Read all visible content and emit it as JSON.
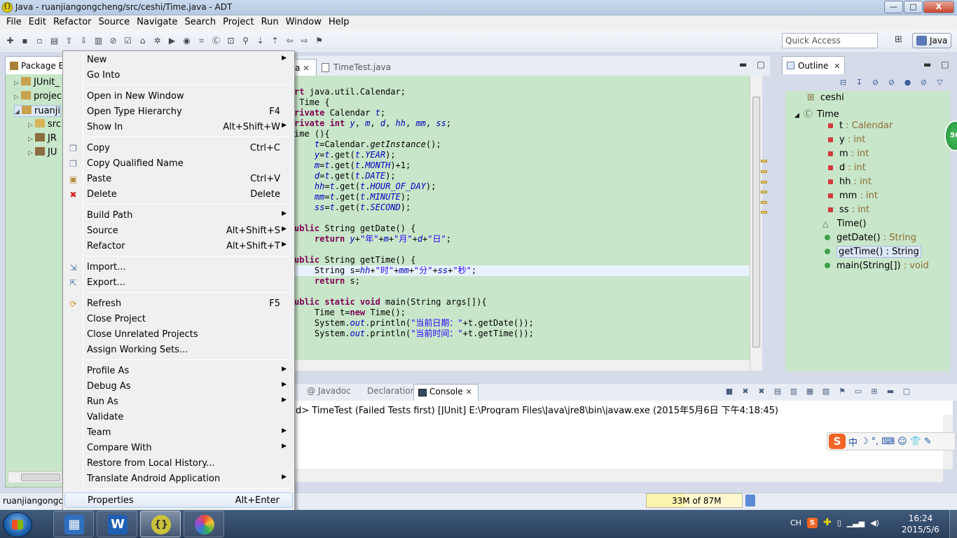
{
  "window": {
    "title": "Java - ruanjiangongcheng/src/ceshi/Time.java - ADT",
    "app_icon": "{}",
    "buttons": [
      "—",
      "□",
      "X"
    ]
  },
  "menubar": [
    "File",
    "Edit",
    "Refactor",
    "Source",
    "Navigate",
    "Search",
    "Project",
    "Run",
    "Window",
    "Help"
  ],
  "toolbar": {
    "quick_access": "Quick Access",
    "perspective": "Java"
  },
  "package_explorer": {
    "tab": "Package Ex",
    "items": [
      {
        "arrow": "▷",
        "label": "JUnit_"
      },
      {
        "arrow": "▷",
        "label": "projec"
      },
      {
        "arrow": "◢",
        "label": "ruanji"
      },
      {
        "arrow": "▷",
        "label": "src"
      },
      {
        "arrow": "▷",
        "label": "JR"
      },
      {
        "arrow": "▷",
        "label": "JU"
      }
    ]
  },
  "editor": {
    "active_tab": "a",
    "other_tab": "TimeTest.java",
    "lines": [
      "rt java.util.Calendar;",
      " Time {",
      "rivate Calendar t;",
      "rivate int y, m, d, hh, mm, ss;",
      "ime (){",
      "    t=Calendar.getInstance();",
      "    y=t.get(t.YEAR);",
      "    m=t.get(t.MONTH)+1;",
      "    d=t.get(t.DATE);",
      "    hh=t.get(t.HOUR_OF_DAY);",
      "    mm=t.get(t.MINUTE);",
      "    ss=t.get(t.SECOND);",
      "",
      "ublic String getDate() {",
      "    return y+\"年\"+m+\"月\"+d+\"日\";",
      "",
      "ublic String getTime() {",
      "    String s=hh+\"时\"+mm+\"分\"+ss+\"秒\";",
      "    return s;",
      "",
      "ublic static void main(String args[]){",
      "    Time t=new Time();",
      "    System.out.println(\"当前日期：\"+t.getDate());",
      "    System.out.println(\"当前时间：\"+t.getTime());"
    ]
  },
  "outline": {
    "tab": "Outline",
    "items": [
      {
        "name": "ceshi",
        "type": ""
      },
      {
        "name": "Time",
        "type": ""
      },
      {
        "name": "t",
        "type": " : Calendar"
      },
      {
        "name": "y",
        "type": " : int"
      },
      {
        "name": "m",
        "type": " : int"
      },
      {
        "name": "d",
        "type": " : int"
      },
      {
        "name": "hh",
        "type": " : int"
      },
      {
        "name": "mm",
        "type": " : int"
      },
      {
        "name": "ss",
        "type": " : int"
      },
      {
        "name": "Time()",
        "type": ""
      },
      {
        "name": "getDate()",
        "type": " : String"
      },
      {
        "name": "getTime() : String",
        "type": ""
      },
      {
        "name": "main(String[])",
        "type": " : void"
      }
    ],
    "badge": "56"
  },
  "bottom": {
    "tabs": {
      "javadoc": "@ Javadoc",
      "declaration": "Declaration",
      "console": "Console"
    },
    "console_status": "d> TimeTest (Failed Tests first) [JUnit] E:\\Program Files\\Java\\jre8\\bin\\javaw.exe (2015年5月6日 下午4:18:45)"
  },
  "context_menu": {
    "items": [
      {
        "label": "New",
        "shortcut": "",
        "sub": true
      },
      {
        "label": "Go Into",
        "shortcut": "",
        "sub": false
      },
      {
        "label": "Open in New Window",
        "shortcut": "",
        "sub": false
      },
      {
        "label": "Open Type Hierarchy",
        "shortcut": "F4",
        "sub": false
      },
      {
        "label": "Show In",
        "shortcut": "Alt+Shift+W",
        "sub": true
      },
      {
        "label": "Copy",
        "shortcut": "Ctrl+C",
        "sub": false
      },
      {
        "label": "Copy Qualified Name",
        "shortcut": "",
        "sub": false
      },
      {
        "label": "Paste",
        "shortcut": "Ctrl+V",
        "sub": false
      },
      {
        "label": "Delete",
        "shortcut": "Delete",
        "sub": false
      },
      {
        "label": "Build Path",
        "shortcut": "",
        "sub": true
      },
      {
        "label": "Source",
        "shortcut": "Alt+Shift+S",
        "sub": true
      },
      {
        "label": "Refactor",
        "shortcut": "Alt+Shift+T",
        "sub": true
      },
      {
        "label": "Import...",
        "shortcut": "",
        "sub": false
      },
      {
        "label": "Export...",
        "shortcut": "",
        "sub": false
      },
      {
        "label": "Refresh",
        "shortcut": "F5",
        "sub": false
      },
      {
        "label": "Close Project",
        "shortcut": "",
        "sub": false
      },
      {
        "label": "Close Unrelated Projects",
        "shortcut": "",
        "sub": false
      },
      {
        "label": "Assign Working Sets...",
        "shortcut": "",
        "sub": false
      },
      {
        "label": "Profile As",
        "shortcut": "",
        "sub": true
      },
      {
        "label": "Debug As",
        "shortcut": "",
        "sub": true
      },
      {
        "label": "Run As",
        "shortcut": "",
        "sub": true
      },
      {
        "label": "Validate",
        "shortcut": "",
        "sub": false
      },
      {
        "label": "Team",
        "shortcut": "",
        "sub": true
      },
      {
        "label": "Compare With",
        "shortcut": "",
        "sub": true
      },
      {
        "label": "Restore from Local History...",
        "shortcut": "",
        "sub": false
      },
      {
        "label": "Translate Android Application",
        "shortcut": "",
        "sub": true
      },
      {
        "label": "Properties",
        "shortcut": "Alt+Enter",
        "sub": false
      }
    ],
    "submenu_glyph": "▶"
  },
  "ime": {
    "lang": "中",
    "moon": "☽",
    "punct": "°,"
  },
  "statusbar": {
    "left": "ruanjiangongcl",
    "heap": "33M of 87M"
  },
  "taskbar": {
    "apps": [
      {
        "name": "file-manager",
        "glyph": "▦",
        "color": "#2f6fbf"
      },
      {
        "name": "wps-writer",
        "glyph": "W",
        "color": "#1f5fb4"
      },
      {
        "name": "adt-eclipse",
        "glyph": "{}",
        "color": "#c9c23a"
      },
      {
        "name": "picasa",
        "glyph": "●",
        "color": "#d94b84"
      }
    ],
    "tray": {
      "lang": "CH",
      "sogou": "S"
    },
    "time": "16:24",
    "date": "2015/5/6"
  },
  "colors": {
    "panel_green": "#c8e6c9",
    "keyword": "#7f0055",
    "field": "#0000c0",
    "string": "#2a00ff"
  }
}
